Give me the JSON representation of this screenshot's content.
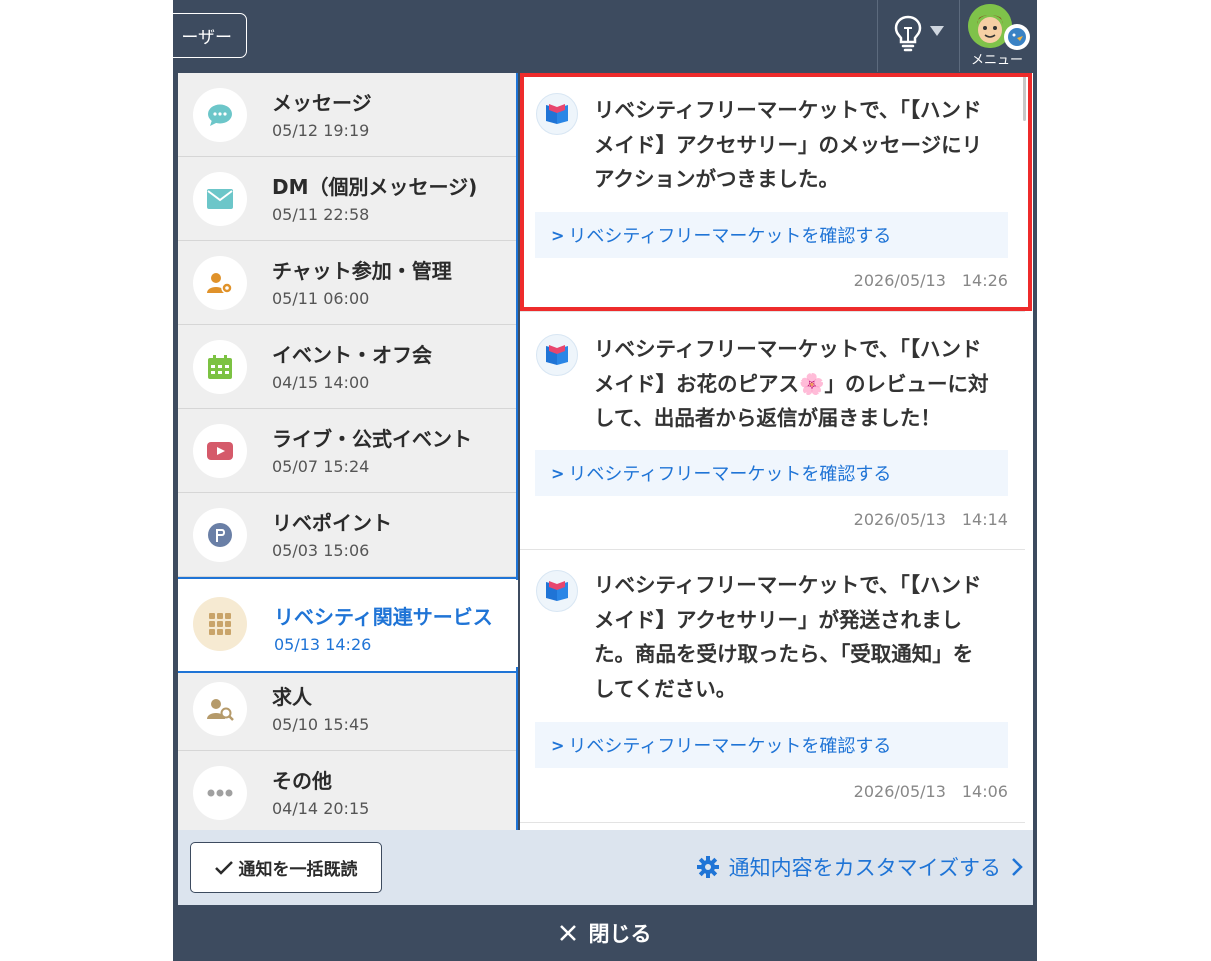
{
  "header": {
    "user_button_label": "ーザー",
    "menu_label": "メニュー"
  },
  "categories": [
    {
      "title": "メッセージ",
      "time": "05/12 19:19",
      "icon": "speech-bubble-icon"
    },
    {
      "title": "DM（個別メッセージ)",
      "time": "05/11 22:58",
      "icon": "envelope-icon"
    },
    {
      "title": "チャット参加・管理",
      "time": "05/11 06:00",
      "icon": "user-gear-icon"
    },
    {
      "title": "イベント・オフ会",
      "time": "04/15 14:00",
      "icon": "calendar-icon"
    },
    {
      "title": "ライブ・公式イベント",
      "time": "05/07 15:24",
      "icon": "video-play-icon"
    },
    {
      "title": "リベポイント",
      "time": "05/03 15:06",
      "icon": "point-p-icon"
    },
    {
      "title": "リベシティ関連サービス",
      "time": "05/13 14:26",
      "icon": "grid-icon",
      "active": true
    },
    {
      "title": "求人",
      "time": "05/10 15:45",
      "icon": "user-search-icon"
    },
    {
      "title": "その他",
      "time": "04/14 20:15",
      "icon": "more-dots-icon"
    }
  ],
  "notifications": [
    {
      "lines": [
        "リベシティフリーマーケットで、「【ハンド",
        "メイド】アクセサリー」のメッセージにリ",
        "アクションがつきました。"
      ],
      "link": "リベシティフリーマーケットを確認する",
      "date": "2026/05/13　14:26"
    },
    {
      "lines": [
        "リベシティフリーマーケットで、「【ハンド",
        "メイド】お花のピアス🌸」のレビューに対",
        "して、出品者から返信が届きました！"
      ],
      "link": "リベシティフリーマーケットを確認する",
      "date": "2026/05/13　14:14"
    },
    {
      "lines": [
        "リベシティフリーマーケットで、「【ハンド",
        "メイド】アクセサリー」が発送されまし",
        "た。商品を受け取ったら、「受取通知」を",
        "してください。"
      ],
      "link": "リベシティフリーマーケットを確認する",
      "date": "2026/05/13　14:06"
    }
  ],
  "footer": {
    "mark_all_read": "通知を一括既読",
    "customize": "通知内容をカスタマイズする",
    "close": "閉じる"
  },
  "colors": {
    "frame": "#3d4b5f",
    "accent": "#1f74d6",
    "highlight": "#ee2b2b"
  }
}
